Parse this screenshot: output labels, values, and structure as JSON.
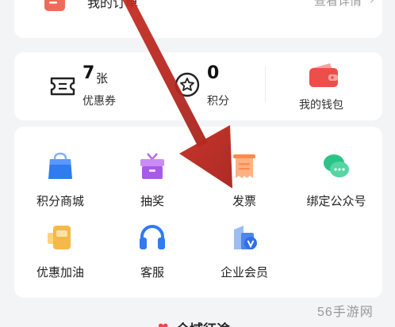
{
  "order": {
    "title": "我的订单",
    "detail_link": "查看详情",
    "chevron": "›"
  },
  "stats": {
    "coupons": {
      "count": "7",
      "unit": "张",
      "label": "优惠券",
      "icon": "ticket-icon"
    },
    "points": {
      "count": "0",
      "label": "积分",
      "icon": "star-coin-icon"
    },
    "wallet": {
      "label": "我的钱包",
      "icon": "wallet-icon"
    }
  },
  "services": [
    {
      "label": "积分商城",
      "icon": "shopping-bag-icon"
    },
    {
      "label": "抽奖",
      "icon": "gift-box-icon"
    },
    {
      "label": "发票",
      "icon": "invoice-icon"
    },
    {
      "label": "绑定公众号",
      "icon": "wechat-icon"
    },
    {
      "label": "优惠加油",
      "icon": "fuel-can-icon"
    },
    {
      "label": "客服",
      "icon": "headset-icon"
    },
    {
      "label": "企业会员",
      "icon": "enterprise-member-icon"
    }
  ],
  "bottom": {
    "title": "全域征途"
  },
  "watermark": "56手游网",
  "colors": {
    "accent_red": "#e8473f",
    "arrow_red": "#c42a20",
    "blue": "#2f7bf0",
    "purple": "#b86ef0",
    "orange": "#ff8a4b",
    "green": "#2cc38a",
    "yellow": "#f5b84a"
  }
}
